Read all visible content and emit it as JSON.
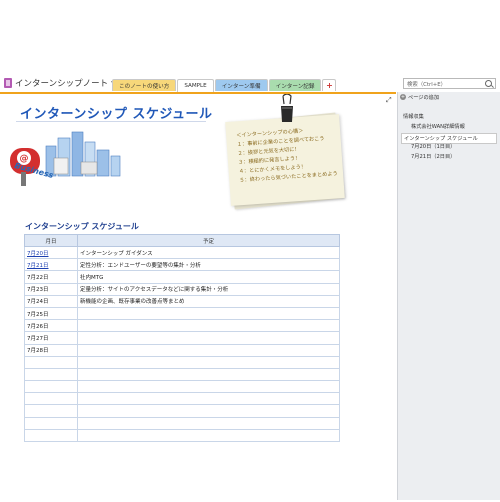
{
  "notebook": {
    "title": "インターンシップノート"
  },
  "tabs": [
    {
      "label": "このノートの使い方",
      "color": "#f7d77a"
    },
    {
      "label": "SAMPLE",
      "color": "#ffffff"
    },
    {
      "label": "インターン準備",
      "color": "#9ec9ef"
    },
    {
      "label": "インターン記録",
      "color": "#a9dcae"
    },
    {
      "label": "+",
      "color": "#ffffff"
    }
  ],
  "search": {
    "placeholder": "検索（Ctrl+E）"
  },
  "page": {
    "title": "インターンシップ スケジュール",
    "business_text": "Business"
  },
  "note": {
    "heading": "＜インターンシップの心構＞",
    "items": [
      "１：事前に企業のことを調べておこう",
      "２：挨拶と元気を大切に！",
      "３：積極的に発言しよう！",
      "４：とにかくメモをしよう！",
      "５：終わったら気づいたことをまとめよう"
    ]
  },
  "schedule": {
    "title": "インターンシップ スケジュール",
    "headers": [
      "月日",
      "予定"
    ],
    "rows": [
      [
        "7月20日",
        "インターンシップ ガイダンス"
      ],
      [
        "7月21日",
        "定性分析：エンドユーザーの要望等の集計・分析"
      ],
      [
        "7月22日",
        "社内MTG"
      ],
      [
        "7月23日",
        "定量分析：サイトのアクセスデータなどに関する集計・分析"
      ],
      [
        "7月24日",
        "新機能の企画、既存事業の改善点等まとめ"
      ],
      [
        "7月25日",
        ""
      ],
      [
        "7月26日",
        ""
      ],
      [
        "7月27日",
        ""
      ],
      [
        "7月28日",
        ""
      ],
      [
        "",
        ""
      ],
      [
        "",
        ""
      ],
      [
        "",
        ""
      ],
      [
        "",
        ""
      ],
      [
        "",
        ""
      ],
      [
        "",
        ""
      ],
      [
        "",
        ""
      ]
    ]
  },
  "sidebar": {
    "add_page": "ページの追加",
    "items": [
      {
        "label": "情報収集",
        "indent": 0
      },
      {
        "label": "株式会社WAN詳細情報",
        "indent": 1
      },
      {
        "label": "インターンシップ スケジュール",
        "indent": 0,
        "active": true
      },
      {
        "label": "7月20日（1日目）",
        "indent": 1
      },
      {
        "label": "7月21日（2日目）",
        "indent": 1
      }
    ]
  }
}
